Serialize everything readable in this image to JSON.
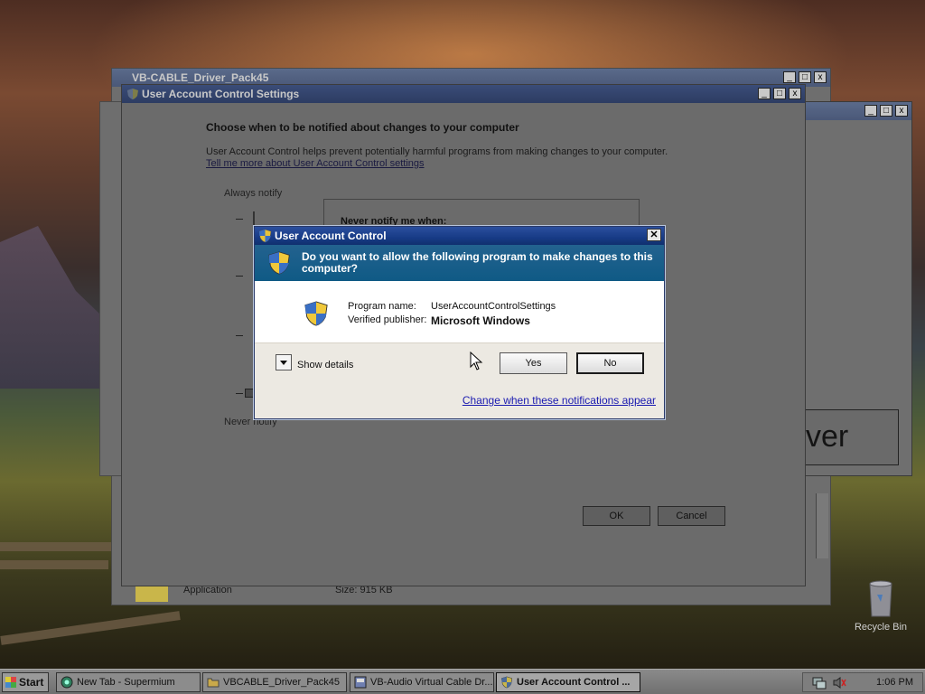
{
  "settings_window": {
    "title": "User Account Control Settings",
    "heading": "Choose when to be notified about changes to your computer",
    "description": "User Account Control helps prevent potentially harmful programs from making changes to your computer.",
    "link": "Tell me more about User Account Control settings",
    "slider_top_label": "Always notify",
    "slider_bottom_label": "Never notify",
    "box_title": "Never notify me when:",
    "ok_label": "OK",
    "cancel_label": "Cancel"
  },
  "background_windows": {
    "driver_window_title": "VB-CABLE_Driver_Pack45",
    "file_type": "Application",
    "file_size": "Size: 915 KB",
    "right_partial_text": "ver"
  },
  "uac_dialog": {
    "title": "User Account Control",
    "close_label": "✕",
    "question": "Do you want to allow the following program to make changes to this computer?",
    "program_name_label": "Program name:",
    "program_name_value": "UserAccountControlSettings",
    "publisher_label": "Verified publisher:",
    "publisher_value": "Microsoft Windows",
    "show_details_label": "Show details",
    "yes_label": "Yes",
    "no_label": "No",
    "notifications_link": "Change when these notifications appear"
  },
  "desktop": {
    "recycle_bin_label": "Recycle Bin"
  },
  "taskbar": {
    "start_label": "Start",
    "buttons": [
      {
        "label": "New Tab - Supermium",
        "icon": "browser-icon",
        "active": false
      },
      {
        "label": "VBCABLE_Driver_Pack45",
        "icon": "folder-icon",
        "active": false
      },
      {
        "label": "VB-Audio Virtual Cable Dr...",
        "icon": "installer-icon",
        "active": false
      },
      {
        "label": "User Account Control ...",
        "icon": "shield-icon",
        "active": true
      }
    ],
    "clock": "1:06 PM"
  },
  "colors": {
    "uac_title": "#173b86",
    "uac_banner": "#1a5e89",
    "link": "#1a1ab0"
  }
}
